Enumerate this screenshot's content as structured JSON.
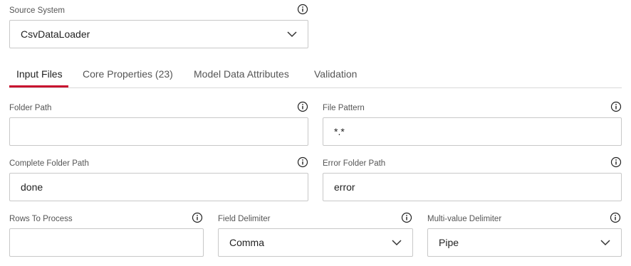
{
  "source_system": {
    "label": "Source System",
    "value": "CsvDataLoader",
    "info_icon": "info-circle-icon",
    "dropdown_icon": "chevron-down-icon"
  },
  "tabs": [
    {
      "label": "Input Files",
      "active": true
    },
    {
      "label": "Core Properties (23)",
      "active": false
    },
    {
      "label": "Model Data Attributes",
      "active": false
    },
    {
      "label": "Validation",
      "active": false
    }
  ],
  "fields": {
    "folder_path": {
      "label": "Folder Path",
      "value": ""
    },
    "file_pattern": {
      "label": "File Pattern",
      "value": "*.*"
    },
    "complete_folder_path": {
      "label": "Complete Folder Path",
      "value": "done"
    },
    "error_folder_path": {
      "label": "Error Folder Path",
      "value": "error"
    },
    "rows_to_process": {
      "label": "Rows To Process",
      "value": ""
    },
    "field_delimiter": {
      "label": "Field Delimiter",
      "value": "Comma"
    },
    "multi_value_delimiter": {
      "label": "Multi-value Delimiter",
      "value": "Pipe"
    }
  },
  "colors": {
    "accent": "#c8102e",
    "border": "#c8c8c8"
  }
}
